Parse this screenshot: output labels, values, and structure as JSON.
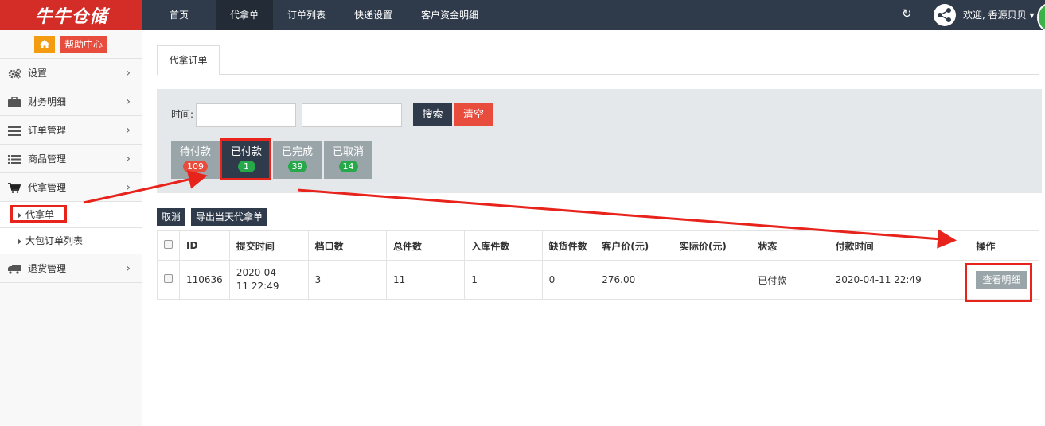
{
  "brand": {
    "logo_text": "牛牛仓储"
  },
  "topnav": {
    "items": [
      {
        "label": "首页",
        "active": false
      },
      {
        "label": "代拿单",
        "active": true
      },
      {
        "label": "订单列表",
        "active": false
      },
      {
        "label": "快递设置",
        "active": false
      },
      {
        "label": "客户资金明细",
        "active": false
      }
    ],
    "welcome": "欢迎, 香源贝贝",
    "icons": [
      "refresh-icon",
      "share-icon"
    ]
  },
  "sidebar": {
    "help_label": "帮助中心",
    "items": [
      {
        "label": "设置",
        "icon": "gear-icon"
      },
      {
        "label": "财务明细",
        "icon": "briefcase-icon"
      },
      {
        "label": "订单管理",
        "icon": "bars-icon"
      },
      {
        "label": "商品管理",
        "icon": "list-icon"
      },
      {
        "label": "代拿管理",
        "icon": "cart-icon"
      },
      {
        "label": "退货管理",
        "icon": "truck-icon"
      }
    ],
    "subitems": [
      {
        "label": "代拿单"
      },
      {
        "label": "大包订单列表"
      }
    ]
  },
  "main": {
    "tab_label": "代拿订单",
    "filter": {
      "time_label": "时间:",
      "separator": "-",
      "search_label": "搜索",
      "clear_label": "清空"
    },
    "statuses": [
      {
        "label": "待付款",
        "count": "109",
        "badge_color": "#e74c3c"
      },
      {
        "label": "已付款",
        "count": "1",
        "badge_color": "#27a84a"
      },
      {
        "label": "已完成",
        "count": "39",
        "badge_color": "#27a84a"
      },
      {
        "label": "已取消",
        "count": "14",
        "badge_color": "#27a84a"
      }
    ],
    "actions": {
      "cancel_label": "取消",
      "export_label": "导出当天代拿单"
    },
    "table": {
      "headers": [
        "ID",
        "提交时间",
        "档口数",
        "总件数",
        "入库件数",
        "缺货件数",
        "客户价(元)",
        "实际价(元)",
        "状态",
        "付款时间",
        "操作"
      ],
      "rows": [
        {
          "id": "110636",
          "submit_time": "2020-04-11 22:49",
          "stalls": "3",
          "total": "11",
          "stocked": "1",
          "missing": "0",
          "customer_price": "276.00",
          "actual_price": "",
          "status": "已付款",
          "pay_time": "2020-04-11 22:49",
          "action_label": "查看明细"
        }
      ]
    }
  },
  "colors": {
    "brand_red": "#d42c27",
    "nav_dark": "#2f3b4b",
    "annotation_red": "#e8231c"
  }
}
